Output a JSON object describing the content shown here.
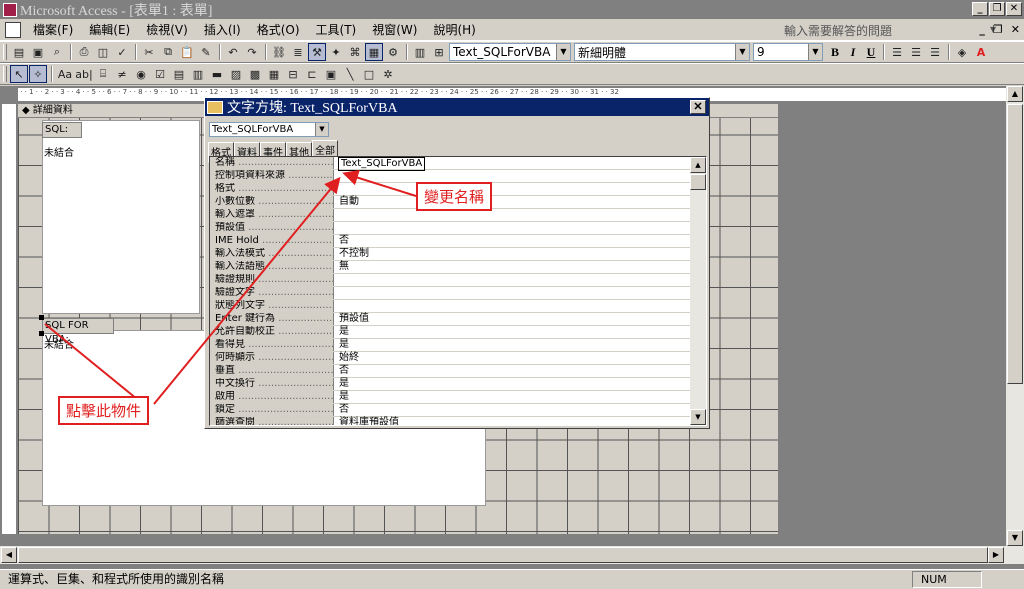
{
  "window": {
    "title": "Microsoft Access - [表單1 : 表單]",
    "controls": [
      "_",
      "❐",
      "✕"
    ]
  },
  "menu": {
    "items": [
      "檔案(F)",
      "編輯(E)",
      "檢視(V)",
      "插入(I)",
      "格式(O)",
      "工具(T)",
      "視窗(W)",
      "說明(H)"
    ],
    "help_placeholder": "輸入需要解答的問題",
    "mdi_controls": [
      "_",
      "❐",
      "✕"
    ]
  },
  "toolbar": {
    "object_combo": "Text_SQLForVBA",
    "font_combo": "新細明體",
    "size_combo": "9",
    "bold": "B",
    "italic": "I",
    "underline": "U"
  },
  "form": {
    "section_header": "◆ 詳細資料",
    "label1": "SQL:",
    "text1": "未結合",
    "label2": "SQL FOR VBA:",
    "text2": "未結合"
  },
  "property_sheet": {
    "title": "文字方塊: Text_SQLForVBA",
    "object_select": "Text_SQLForVBA",
    "tabs": [
      "格式",
      "資料",
      "事件",
      "其他",
      "全部"
    ],
    "active_tab": "全部",
    "rows": [
      {
        "name": "名稱",
        "value": "Text_SQLForVBA"
      },
      {
        "name": "控制項資料來源",
        "value": ""
      },
      {
        "name": "格式",
        "value": ""
      },
      {
        "name": "小數位數",
        "value": "自動"
      },
      {
        "name": "輸入遮罩",
        "value": ""
      },
      {
        "name": "預設值",
        "value": ""
      },
      {
        "name": "IME Hold",
        "value": "否"
      },
      {
        "name": "輸入法模式",
        "value": "不控制"
      },
      {
        "name": "輸入法語態",
        "value": "無"
      },
      {
        "name": "驗證規則",
        "value": ""
      },
      {
        "name": "驗證文字",
        "value": ""
      },
      {
        "name": "狀態列文字",
        "value": ""
      },
      {
        "name": "Enter 鍵行為",
        "value": "預設值"
      },
      {
        "name": "允許自動校正",
        "value": "是"
      },
      {
        "name": "看得見",
        "value": "是"
      },
      {
        "name": "何時顯示",
        "value": "始終"
      },
      {
        "name": "垂直",
        "value": "否"
      },
      {
        "name": "中文換行",
        "value": "是"
      },
      {
        "name": "啟用",
        "value": "是"
      },
      {
        "name": "鎖定",
        "value": "否"
      },
      {
        "name": "篩選查閱",
        "value": "資料庫預設值"
      }
    ]
  },
  "annotations": {
    "rename": "變更名稱",
    "click_object": "點擊此物件",
    "color": "#e02020"
  },
  "status": {
    "text": "運算式、巨集、和程式所使用的識別名稱",
    "num": "NUM"
  }
}
